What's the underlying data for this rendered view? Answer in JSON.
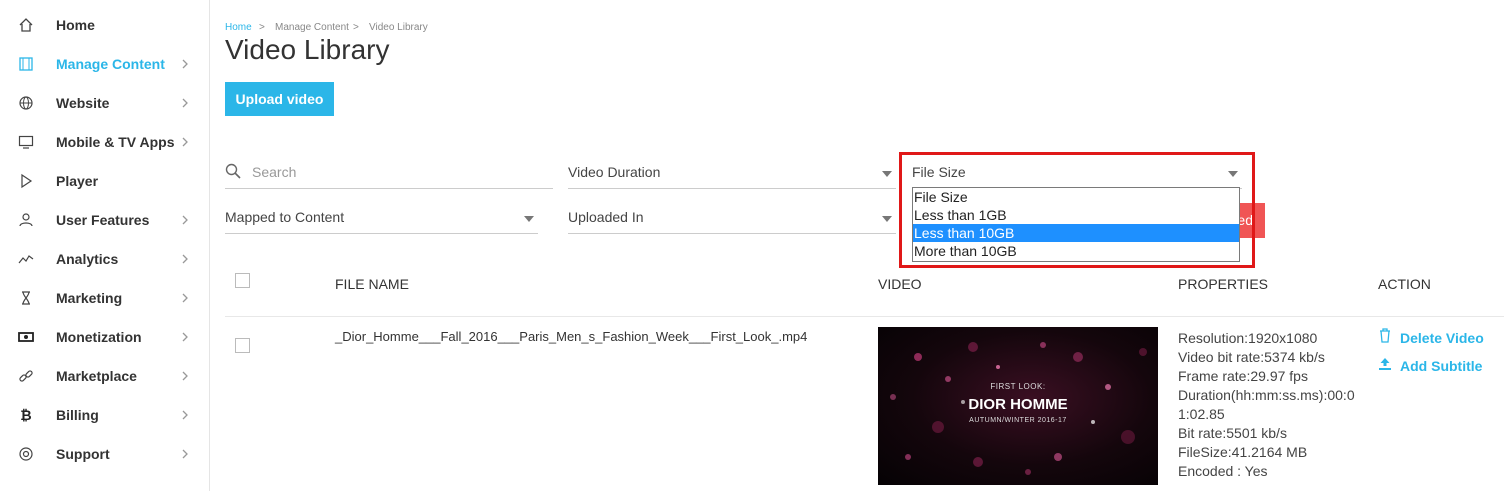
{
  "sidebar": {
    "items": [
      {
        "label": "Home",
        "icon": "home-icon",
        "active": false,
        "chevron": false
      },
      {
        "label": "Manage Content",
        "icon": "film-icon",
        "active": true,
        "chevron": true
      },
      {
        "label": "Website",
        "icon": "globe-icon",
        "active": false,
        "chevron": true
      },
      {
        "label": "Mobile & TV Apps",
        "icon": "monitor-icon",
        "active": false,
        "chevron": true
      },
      {
        "label": "Player",
        "icon": "play-icon",
        "active": false,
        "chevron": false
      },
      {
        "label": "User Features",
        "icon": "user-icon",
        "active": false,
        "chevron": true
      },
      {
        "label": "Analytics",
        "icon": "analytics-icon",
        "active": false,
        "chevron": true
      },
      {
        "label": "Marketing",
        "icon": "hourglass-icon",
        "active": false,
        "chevron": true
      },
      {
        "label": "Monetization",
        "icon": "money-icon",
        "active": false,
        "chevron": true
      },
      {
        "label": "Marketplace",
        "icon": "link-icon",
        "active": false,
        "chevron": true
      },
      {
        "label": "Billing",
        "icon": "bitcoin-icon",
        "active": false,
        "chevron": true
      },
      {
        "label": "Support",
        "icon": "lifebuoy-icon",
        "active": false,
        "chevron": true
      }
    ]
  },
  "breadcrumb": {
    "home": "Home",
    "section": "Manage Content",
    "current": "Video Library",
    "sep": ">"
  },
  "page": {
    "title": "Video Library",
    "upload_label": "Upload video"
  },
  "filters": {
    "search_placeholder": "Search",
    "video_duration": "Video Duration",
    "file_size": "File Size",
    "mapped_to_content": "Mapped to Content",
    "uploaded_in": "Uploaded In",
    "hidden_button_fragment": "ed"
  },
  "file_size_dropdown": {
    "options": [
      "File Size",
      "Less than 1GB",
      "Less than 10GB",
      "More than 10GB"
    ],
    "highlighted": "Less than 10GB"
  },
  "table": {
    "headers": {
      "file_name": "FILE NAME",
      "video": "VIDEO",
      "properties": "PROPERTIES",
      "action": "ACTION"
    },
    "rows": [
      {
        "file_name": "_Dior_Homme___Fall_2016___Paris_Men_s_Fashion_Week___First_Look_.mp4",
        "thumbnail": {
          "line1": "FIRST LOOK:",
          "line2": "DIOR HOMME",
          "line3": "AUTUMN/WINTER 2016-17"
        },
        "properties": [
          "Resolution:1920x1080",
          "Video bit rate:5374 kb/s",
          "Frame rate:29.97 fps",
          "Duration(hh:mm:ss.ms):00:0",
          "1:02.85",
          "Bit rate:5501 kb/s",
          "FileSize:41.2164 MB",
          "Encoded : Yes"
        ],
        "actions": {
          "delete": "Delete Video",
          "subtitle": "Add Subtitle"
        }
      }
    ]
  },
  "colors": {
    "accent": "#2bb6e8",
    "highlight_border": "#e01818",
    "selected_option": "#1e90ff"
  }
}
